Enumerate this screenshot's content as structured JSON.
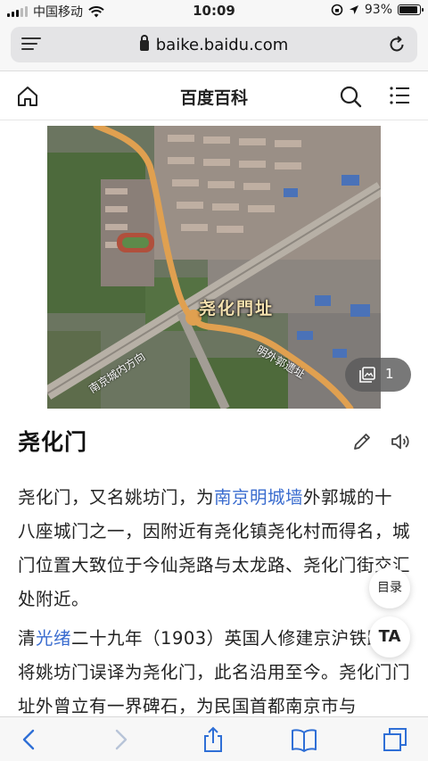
{
  "status_bar": {
    "carrier": "中国移动",
    "time": "10:09",
    "battery": "93%",
    "battery_level": 0.93
  },
  "url_bar": {
    "domain": "baike.baidu.com"
  },
  "header": {
    "site_title": "百度百科"
  },
  "hero": {
    "map_label": "尧化門址",
    "road_label_left": "南京城内方向",
    "road_label_right": "明外郭遗址",
    "image_count": "1"
  },
  "article": {
    "title": "尧化门",
    "para1": {
      "before_link": "尧化门，又名姚坊门，为",
      "link": "南京明城墙",
      "after_link": "外郭城的十八座城门之一，因附近有尧化镇尧化村而得名，城门位置大致位于今仙尧路与太龙路、尧化门街交汇处附近。"
    },
    "para2": {
      "before_link": "清",
      "link": "光绪",
      "after_link": "二十九年（1903）英国人修建京沪铁路时将姚坊门误译为尧化门，此名沿用至今。尧化门门址外曾立有一界碑石，为民国首都南京市与"
    }
  },
  "floating": {
    "toc_label": "目录",
    "ta_label": "TA"
  },
  "colors": {
    "link": "#3a6ccf",
    "road": "#e0a050"
  }
}
